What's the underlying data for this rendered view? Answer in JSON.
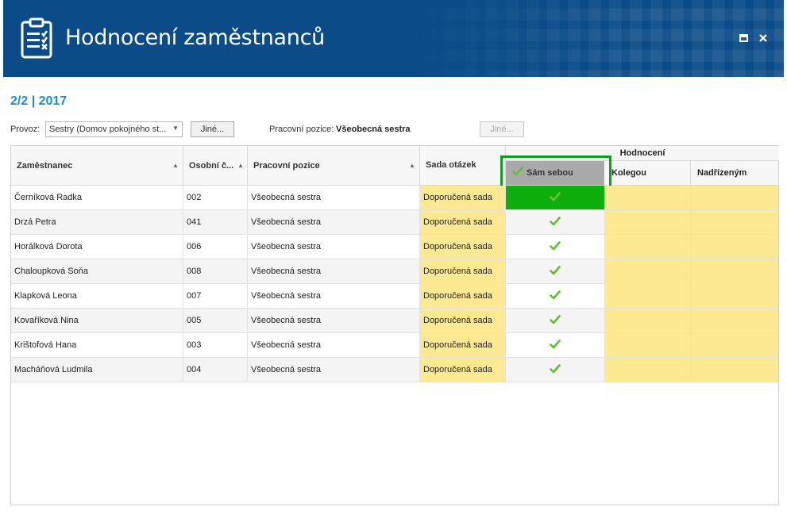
{
  "window": {
    "title": "Hodnocení zaměstnanců",
    "icon": "clipboard-checklist-icon",
    "controls": [
      "maximize-icon",
      "close-icon"
    ]
  },
  "period": "2/2 | 2017",
  "filters": {
    "provoz_label": "Provoz:",
    "provoz_value": "Sestry (Domov pokojného st...",
    "provoz_button": "Jiné...",
    "position_label": "Pracovní pozice:",
    "position_value": "Všeobecná sestra",
    "position_button": "Jiné..."
  },
  "grid": {
    "columns": {
      "employee": "Zaměstnanec",
      "number": "Osobní č...",
      "position": "Pracovní pozice",
      "question_set": "Sada otázek",
      "evaluation_group": "Hodnocení",
      "self": "Sám sebou",
      "colleague": "Kolegou",
      "superior": "Nadřízeným"
    },
    "rows": [
      {
        "name": "Černíková Radka",
        "number": "002",
        "position": "Všeobecná sestra",
        "set": "Doporučená sada",
        "self_done": true
      },
      {
        "name": "Drzá Petra",
        "number": "041",
        "position": "Všeobecná sestra",
        "set": "Doporučená sada",
        "self_done": true
      },
      {
        "name": "Horálková Dorota",
        "number": "006",
        "position": "Všeobecná sestra",
        "set": "Doporučená sada",
        "self_done": true
      },
      {
        "name": "Chaloupková Soňa",
        "number": "008",
        "position": "Všeobecná sestra",
        "set": "Doporučená sada",
        "self_done": true
      },
      {
        "name": "Klapková Leona",
        "number": "007",
        "position": "Všeobecná sestra",
        "set": "Doporučená sada",
        "self_done": true
      },
      {
        "name": "Kovaříková Nina",
        "number": "005",
        "position": "Všeobecná sestra",
        "set": "Doporučená sada",
        "self_done": true
      },
      {
        "name": "Krištofová Hana",
        "number": "003",
        "position": "Všeobecná sestra",
        "set": "Doporučená sada",
        "self_done": true
      },
      {
        "name": "Macháňová Ludmila",
        "number": "004",
        "position": "Všeobecná sestra",
        "set": "Doporučená sada",
        "self_done": true
      }
    ]
  },
  "colors": {
    "header": "#0a4b88",
    "accent": "#1a8fd0",
    "set_yellow": "#fde991",
    "selected_green": "#0fae0f",
    "check_green": "#5fbf2a"
  }
}
